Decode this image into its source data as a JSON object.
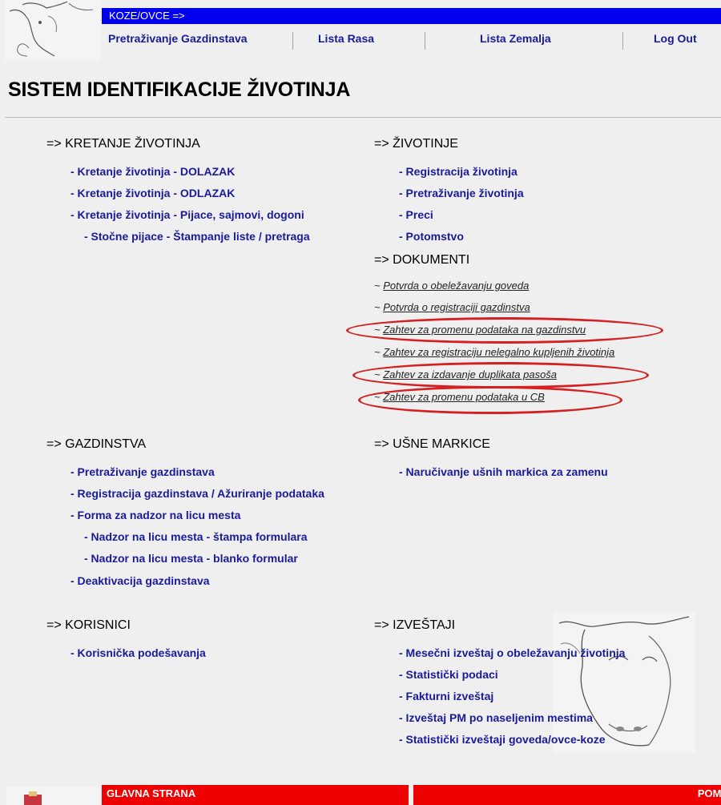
{
  "header": {
    "bluebar_label": "KOZE/OVCE  =>",
    "nav": [
      {
        "label": "Pretraživanje Gazdinstava"
      },
      {
        "label": "Lista Rasa"
      },
      {
        "label": "Lista Zemalja"
      },
      {
        "label": "Log Out"
      }
    ]
  },
  "page_title": "SISTEM IDENTIFIKACIJE ŽIVOTINJA",
  "sections": {
    "kretanje": {
      "heading": "=> KRETANJE ŽIVOTINJA",
      "links": [
        "- Kretanje životinja - DOLAZAK",
        "- Kretanje životinja - ODLAZAK",
        "- Kretanje životinja - Pijace, sajmovi, dogoni",
        "- Stočne pijace - Štampanje liste / pretraga"
      ]
    },
    "zivotinje": {
      "heading": "=> ŽIVOTINJE",
      "links": [
        "- Registracija životinja",
        "- Pretraživanje životinja",
        "- Preci",
        "- Potomstvo"
      ]
    },
    "dokumenti": {
      "heading": "=> DOKUMENTI",
      "tilde": "~",
      "links": [
        "Potvrda o obeležavanju goveda",
        "Potvrda o registraciji gazdinstva",
        "Zahtev za promenu podataka na gazdinstvu",
        "Zahtev za registraciju nelegalno kupljenih životinja",
        "Zahtev za izdavanje duplikata pasoša",
        "Zahtev za promenu podataka u CB"
      ]
    },
    "gazdinstva": {
      "heading": "=> GAZDINSTVA",
      "links": [
        "- Pretraživanje gazdinstava",
        "- Registracija gazdinstava / Ažuriranje podataka",
        "- Forma za nadzor na licu mesta",
        "- Nadzor na licu mesta - štampa formulara",
        "- Nadzor na licu mesta - blanko formular",
        "- Deaktivacija gazdinstava"
      ]
    },
    "usne_markice": {
      "heading": "=> UŠNE MARKICE",
      "links": [
        "- Naručivanje ušnih markica za zamenu"
      ]
    },
    "korisnici": {
      "heading": "=> KORISNICI",
      "links": [
        "- Korisnička podešavanja"
      ]
    },
    "izvestaji": {
      "heading": "=> IZVEŠTAJI",
      "links": [
        "- Mesečni izveštaj o obeležavanju životinja",
        "- Statistički podaci",
        "- Fakturni izveštaj",
        "- Izveštaj PM po naseljenim mestima",
        "- Statistički izveštaji goveda/ovce-koze"
      ]
    }
  },
  "footer": {
    "home_label": "GLAVNA STRANA",
    "help_label": "POMOĆ"
  },
  "colors": {
    "blue_bar": "#0000ee",
    "link": "#1a1a9a",
    "red_bar": "#ee0000",
    "highlight_oval": "#d42020"
  }
}
